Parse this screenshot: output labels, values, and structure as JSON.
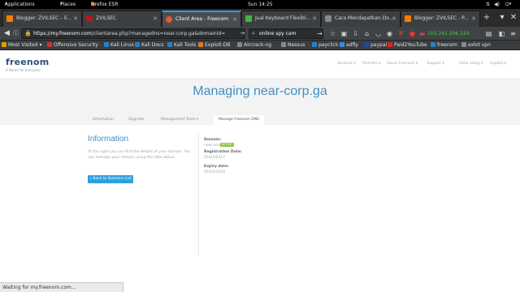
{
  "topbar": {
    "applications": "Applications",
    "places": "Places",
    "app_name": "Firefox ESR",
    "clock": "Sun 14:25"
  },
  "tabs": [
    {
      "label": "Blogger: ZVILSEC – E...",
      "favicon_color": "#f57d00"
    },
    {
      "label": "ZVILSEC",
      "favicon_color": "#b31b1b"
    },
    {
      "label": "Client Area - Freenom",
      "favicon_color": "#e05a2b"
    },
    {
      "label": "Jual Keyboard Flexibl...",
      "favicon_color": "#42b549"
    },
    {
      "label": "Cara Mendapatkan Do...",
      "favicon_color": "#888888"
    },
    {
      "label": "Blogger: ZVILSEC - P...",
      "favicon_color": "#f57d00"
    }
  ],
  "navbar": {
    "url_host": "https://my.freenom.com",
    "url_path": "/clientarea.php?managedns=near-corp.ga&domainid=",
    "search_value": "online spy cam",
    "ip_address": "103.242.206.224"
  },
  "bookmarks": [
    {
      "label": "Most Visited",
      "color": "#d9a400"
    },
    {
      "label": "Offensive Security",
      "color": "#c33"
    },
    {
      "label": "Kali Linux",
      "color": "#2d7fc1"
    },
    {
      "label": "Kali Docs",
      "color": "#2d7fc1"
    },
    {
      "label": "Kali Tools",
      "color": "#2d7fc1"
    },
    {
      "label": "Exploit-DB",
      "color": "#e07b2b"
    },
    {
      "label": "Aircrack-ng",
      "color": "#888"
    },
    {
      "label": "Nessus",
      "color": "#888"
    },
    {
      "label": "payclick",
      "color": "#2d7fc1"
    },
    {
      "label": "adfly",
      "color": "#3d8bd4"
    },
    {
      "label": "paypal",
      "color": "#1a4d97"
    },
    {
      "label": "Paid2YouTube",
      "color": "#d22"
    },
    {
      "label": "freenom",
      "color": "#2d7fc1"
    },
    {
      "label": "exlot vpn",
      "color": "#888"
    }
  ],
  "site": {
    "logo": "freenom",
    "tagline": "A Name for Everyone",
    "nav": [
      "Services ▾",
      "Partners ▾",
      "About Freenom ▾",
      "Support ▾",
      "Hello ading ▾",
      "English ▾"
    ]
  },
  "banner": {
    "title": "Managing near-corp.ga"
  },
  "subtabs": [
    "Information",
    "Upgrade",
    "Management Tools ▾",
    "Manage Freenom DNS"
  ],
  "info": {
    "title": "Information",
    "text": "To the right you can find the details of your domain. You can manage your domain using the tabs above.",
    "back_button": "« Back to Domains List",
    "domain_label": "Domain:",
    "domain_value": "near-corp.ga",
    "status_badge": "ACTIVE",
    "reg_label": "Registration Date:",
    "reg_value": "05/03/2017",
    "exp_label": "Expiry date:",
    "exp_value": "05/03/2018"
  },
  "status_text": "Waiting for my.freenom.com..."
}
